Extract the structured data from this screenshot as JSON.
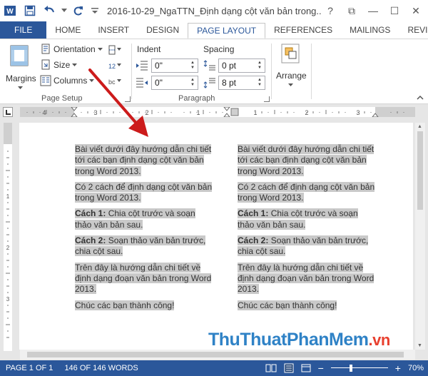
{
  "title_bar": {
    "doc_title": "2016-10-29_NgaTTN_Định dạng cột văn bản trong...",
    "help": "?",
    "restore": "⧉",
    "minimize": "—",
    "maximize": "☐",
    "close": "✕"
  },
  "tabs": [
    "FILE",
    "HOME",
    "INSERT",
    "DESIGN",
    "PAGE LAYOUT",
    "REFERENCES",
    "MAILINGS",
    "REVI"
  ],
  "active_tab": "PAGE LAYOUT",
  "ribbon": {
    "margins_label": "Margins",
    "orientation_label": "Orientation",
    "size_label": "Size",
    "columns_label": "Columns",
    "page_setup_label": "Page Setup",
    "indent_label": "Indent",
    "indent_left": "0\"",
    "indent_right": "0\"",
    "spacing_label": "Spacing",
    "spacing_before": "0 pt",
    "spacing_after": "8 pt",
    "paragraph_label": "Paragraph",
    "arrange_label": "Arrange"
  },
  "document": {
    "columns": [
      {
        "p1": "Bài viết dưới đây hướng dẫn chi tiết tới các bạn định dạng cột văn bản trong Word 2013.",
        "p2": "Có 2 cách để định dạng cột văn bản trong Word 2013.",
        "p3_bold": "Cách 1:",
        "p3_text": " Chia cột trước và soạn thảo văn bản sau.",
        "p4_bold": "Cách 2:",
        "p4_text": " Soạn thảo văn bản trước, chia cột sau.",
        "p5": "Trên đây là hướng dẫn chi tiết về định dạng đoạn văn bản trong Word 2013.",
        "p6": "Chúc các bạn thành công!"
      },
      {
        "p1": "Bài viết dưới đây hướng dẫn chi tiết tới các bạn định dạng cột văn bản trong Word 2013.",
        "p2": "Có 2 cách để định dạng cột văn bản trong Word 2013.",
        "p3_bold": "Cách 1:",
        "p3_text": " Chia cột trước và soạn thảo văn bản sau.",
        "p4_bold": "Cách 2:",
        "p4_text": " Soạn thảo văn bản trước, chia cột sau.",
        "p5": "Trên đây là hướng dẫn chi tiết về định dạng đoạn văn bản trong Word 2013.",
        "p6": "Chúc các bạn thành công!"
      }
    ]
  },
  "status_bar": {
    "page": "PAGE 1 OF 1",
    "words": "146 OF 146 WORDS",
    "zoom_minus": "−",
    "zoom_plus": "+",
    "zoom": "70%"
  },
  "watermark": {
    "part1": "Thu",
    "part2": "Thuat",
    "part3": "PhanMem",
    "suffix": ".vn"
  },
  "colors": {
    "accent": "#2b579a",
    "highlight": "#c9c9c9",
    "annotation_arrow": "#cc1b1b"
  },
  "icons": [
    "save-icon",
    "undo-icon",
    "redo-icon",
    "customize-qat-icon",
    "margins-icon",
    "orientation-icon",
    "size-icon",
    "columns-icon",
    "breaks-icon",
    "line-numbers-icon",
    "hyphenation-icon",
    "indent-left-icon",
    "indent-right-icon",
    "spacing-before-icon",
    "spacing-after-icon",
    "arrange-icon",
    "read-mode-icon",
    "print-layout-icon",
    "web-layout-icon"
  ]
}
